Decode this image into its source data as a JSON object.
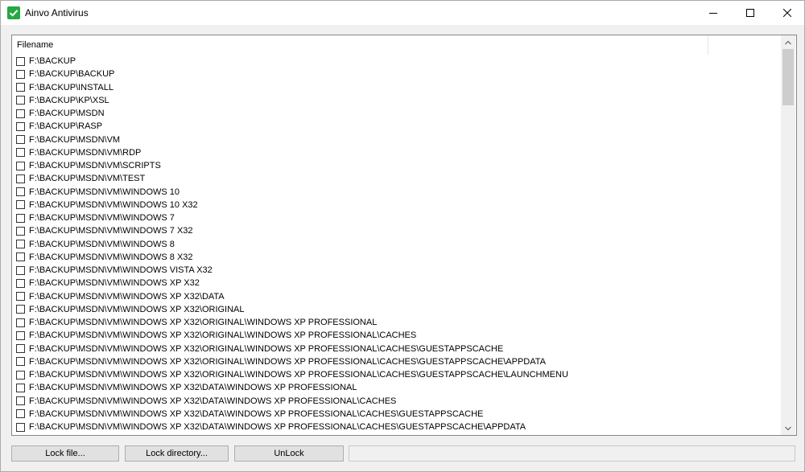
{
  "window": {
    "title": "Ainvo Antivirus",
    "accent_color": "#27a844"
  },
  "list": {
    "column_header": "Filename",
    "items": [
      "F:\\BACKUP",
      "F:\\BACKUP\\BACKUP",
      "F:\\BACKUP\\INSTALL",
      "F:\\BACKUP\\KP\\XSL",
      "F:\\BACKUP\\MSDN",
      "F:\\BACKUP\\RASP",
      "F:\\BACKUP\\MSDN\\VM",
      "F:\\BACKUP\\MSDN\\VM\\RDP",
      "F:\\BACKUP\\MSDN\\VM\\SCRIPTS",
      "F:\\BACKUP\\MSDN\\VM\\TEST",
      "F:\\BACKUP\\MSDN\\VM\\WINDOWS 10",
      "F:\\BACKUP\\MSDN\\VM\\WINDOWS 10 X32",
      "F:\\BACKUP\\MSDN\\VM\\WINDOWS 7",
      "F:\\BACKUP\\MSDN\\VM\\WINDOWS 7 X32",
      "F:\\BACKUP\\MSDN\\VM\\WINDOWS 8",
      "F:\\BACKUP\\MSDN\\VM\\WINDOWS 8 X32",
      "F:\\BACKUP\\MSDN\\VM\\WINDOWS VISTA X32",
      "F:\\BACKUP\\MSDN\\VM\\WINDOWS XP X32",
      "F:\\BACKUP\\MSDN\\VM\\WINDOWS XP X32\\DATA",
      "F:\\BACKUP\\MSDN\\VM\\WINDOWS XP X32\\ORIGINAL",
      "F:\\BACKUP\\MSDN\\VM\\WINDOWS XP X32\\ORIGINAL\\WINDOWS XP PROFESSIONAL",
      "F:\\BACKUP\\MSDN\\VM\\WINDOWS XP X32\\ORIGINAL\\WINDOWS XP PROFESSIONAL\\CACHES",
      "F:\\BACKUP\\MSDN\\VM\\WINDOWS XP X32\\ORIGINAL\\WINDOWS XP PROFESSIONAL\\CACHES\\GUESTAPPSCACHE",
      "F:\\BACKUP\\MSDN\\VM\\WINDOWS XP X32\\ORIGINAL\\WINDOWS XP PROFESSIONAL\\CACHES\\GUESTAPPSCACHE\\APPDATA",
      "F:\\BACKUP\\MSDN\\VM\\WINDOWS XP X32\\ORIGINAL\\WINDOWS XP PROFESSIONAL\\CACHES\\GUESTAPPSCACHE\\LAUNCHMENU",
      "F:\\BACKUP\\MSDN\\VM\\WINDOWS XP X32\\DATA\\WINDOWS XP PROFESSIONAL",
      "F:\\BACKUP\\MSDN\\VM\\WINDOWS XP X32\\DATA\\WINDOWS XP PROFESSIONAL\\CACHES",
      "F:\\BACKUP\\MSDN\\VM\\WINDOWS XP X32\\DATA\\WINDOWS XP PROFESSIONAL\\CACHES\\GUESTAPPSCACHE",
      "F:\\BACKUP\\MSDN\\VM\\WINDOWS XP X32\\DATA\\WINDOWS XP PROFESSIONAL\\CACHES\\GUESTAPPSCACHE\\APPDATA"
    ]
  },
  "buttons": {
    "lock_file": "Lock file...",
    "lock_directory": "Lock directory...",
    "unlock": "UnLock"
  }
}
